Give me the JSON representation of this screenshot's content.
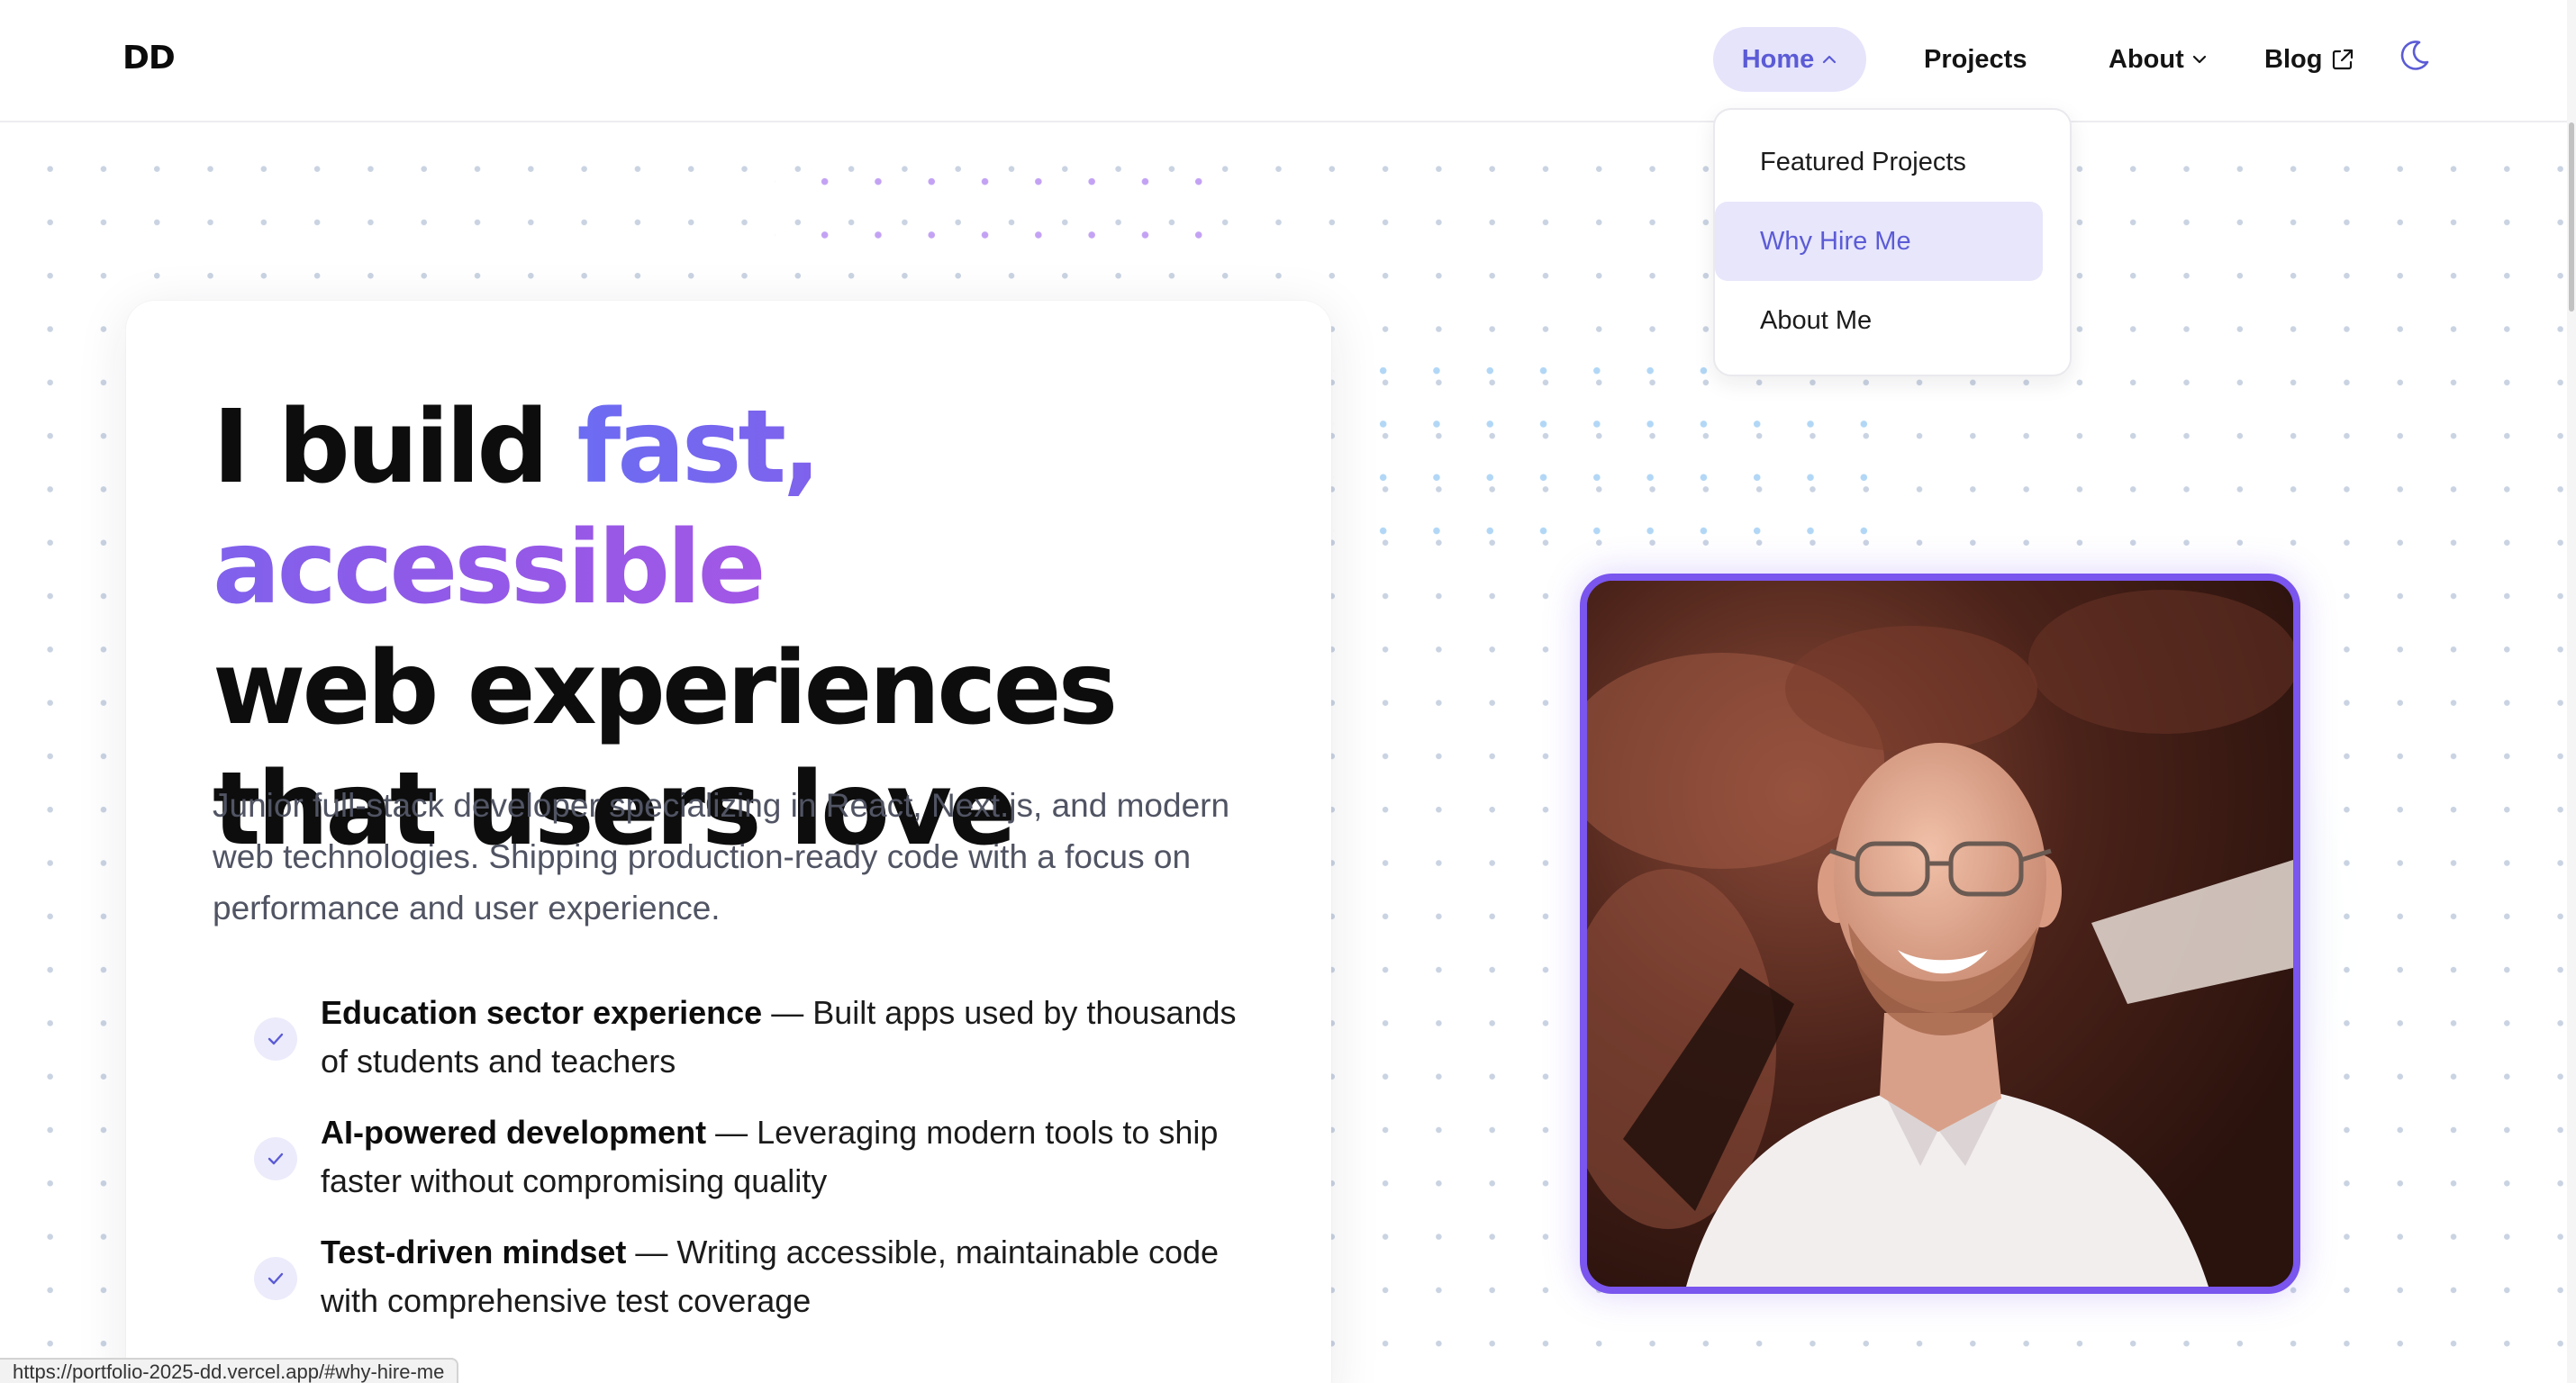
{
  "header": {
    "logo": "DD",
    "nav": {
      "home": "Home",
      "projects": "Projects",
      "about": "About",
      "blog": "Blog"
    }
  },
  "dropdown": {
    "items": [
      "Featured Projects",
      "Why Hire Me",
      "About Me"
    ],
    "active_index": 1
  },
  "hero": {
    "headline": {
      "lead": "I build ",
      "highlight": "fast, accessible",
      "rest": "web experiences that users love"
    },
    "subtitle": "Junior full-stack developer specializing in React, Next.js, and modern web technologies. Shipping production-ready code with a focus on performance and user experience.",
    "bullets": [
      {
        "title": "Education sector experience",
        "text": " — Built apps used by thousands of students and teachers"
      },
      {
        "title": "AI-powered development",
        "text": " — Leveraging modern tools to ship faster without compromising quality"
      },
      {
        "title": "Test-driven mindset",
        "text": " — Writing accessible, maintainable code with comprehensive test coverage"
      }
    ]
  },
  "status_url": "https://portfolio-2025-dd.vercel.app/#why-hire-me",
  "colors": {
    "accent": "#5b5bd6",
    "gradient_start": "#6c6cf2",
    "gradient_end": "#a257e6",
    "photo_border": "#7a55ee"
  },
  "icons": {
    "home_chevron": "chevron-up-icon",
    "about_chevron": "chevron-down-icon",
    "blog": "external-link-icon",
    "theme": "moon-icon",
    "bullet": "check-icon"
  }
}
